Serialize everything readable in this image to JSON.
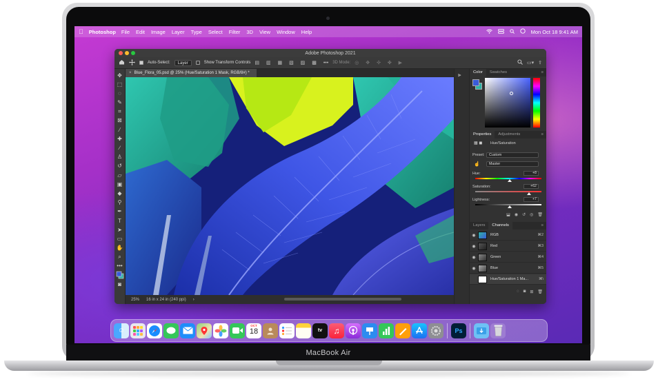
{
  "device": {
    "model_label": "MacBook Air"
  },
  "menubar": {
    "apple_icon": "apple-logo-icon",
    "app_name": "Photoshop",
    "items": [
      "File",
      "Edit",
      "Image",
      "Layer",
      "Type",
      "Select",
      "Filter",
      "3D",
      "View",
      "Window",
      "Help"
    ],
    "clock": "Mon Oct 18  9:41 AM"
  },
  "photoshop": {
    "window_title": "Adobe Photoshop 2021",
    "options": {
      "auto_select_label": "Auto-Select:",
      "auto_select_value": "Layer",
      "transform_label": "Show Transform Controls",
      "mode_3d_label": "3D Mode:"
    },
    "document_tab": "Blue_Flora_05.psd @ 25% (Hue/Saturation 1 Mask, RGB/8#) *",
    "status": {
      "zoom": "25%",
      "doc_size": "16 in x 24 in (240 ppi)"
    },
    "color_panel": {
      "tabs": [
        "Color",
        "Swatches"
      ],
      "foreground": "#3a5bd9",
      "background": "#2fb3a5"
    },
    "properties_panel": {
      "tabs": [
        "Properties",
        "Adjustments"
      ],
      "adjustment_name": "Hue/Saturation",
      "preset_label": "Preset:",
      "preset_value": "Custom",
      "channel_value": "Master",
      "hue_label": "Hue:",
      "hue_value": "+8",
      "hue_level": 0.52,
      "saturation_label": "Saturation:",
      "saturation_value": "+62",
      "saturation_level": 0.81,
      "lightness_label": "Lightness:",
      "lightness_value": "+7",
      "lightness_level": 0.52
    },
    "channels_panel": {
      "tabs": [
        "Layers",
        "Channels"
      ],
      "rows": [
        {
          "name": "RGB",
          "key": "⌘2"
        },
        {
          "name": "Red",
          "key": "⌘3"
        },
        {
          "name": "Green",
          "key": "⌘4"
        },
        {
          "name": "Blue",
          "key": "⌘5"
        },
        {
          "name": "Hue/Saturation 1 Ma...",
          "key": "⌘\\"
        }
      ]
    }
  },
  "dock": {
    "calendar_month": "OCT",
    "calendar_day": "18",
    "ps_label": "Ps",
    "apps": [
      "finder",
      "launchpad",
      "safari",
      "messages",
      "mail",
      "maps",
      "photos",
      "facetime",
      "calendar",
      "contacts",
      "reminders",
      "notes",
      "tv",
      "music",
      "podcasts",
      "keynote",
      "numbers",
      "pages",
      "app-store",
      "system-preferences",
      "photoshop",
      "downloads",
      "trash"
    ]
  }
}
